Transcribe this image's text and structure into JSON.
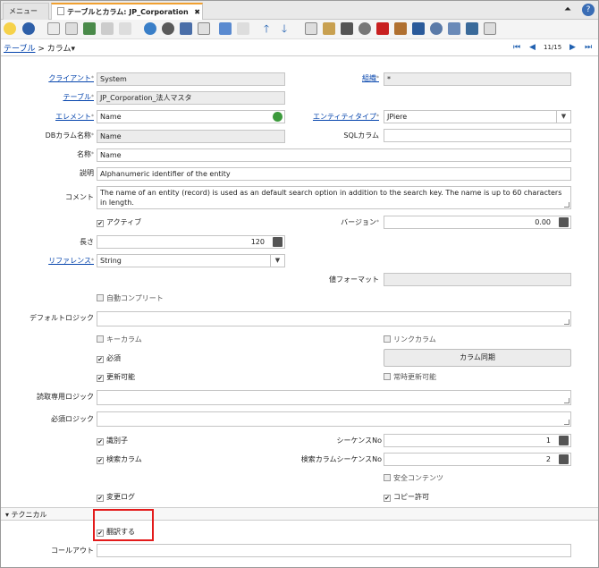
{
  "tabs": {
    "menu": "メニュー",
    "active": "テーブルとカラム: JP_Corporation",
    "close": "✖"
  },
  "breadcrumb": {
    "parent": "テーブル",
    "separator": ">",
    "current": "カラム▾"
  },
  "nav": {
    "record": "11/15"
  },
  "fields": {
    "client": {
      "label": "クライアント",
      "value": "System"
    },
    "org": {
      "label": "組織",
      "value": "*"
    },
    "table": {
      "label": "テーブル",
      "value": "JP_Corporation_法人マスタ"
    },
    "element": {
      "label": "エレメント",
      "value": "Name"
    },
    "entity": {
      "label": "エンティティタイプ",
      "value": "JPiere"
    },
    "dbcol": {
      "label": "DBカラム名称",
      "value": "Name"
    },
    "sqlcol": {
      "label": "SQLカラム",
      "value": ""
    },
    "name": {
      "label": "名称",
      "value": "Name"
    },
    "desc": {
      "label": "説明",
      "value": "Alphanumeric identifier of the entity"
    },
    "comment": {
      "label": "コメント",
      "value": "The name of an entity (record) is used as an default search option in addition to the search key. The name is up to 60 characters in length."
    },
    "active": {
      "label": "アクティブ"
    },
    "version": {
      "label": "バージョン",
      "value": "0.00"
    },
    "length": {
      "label": "長さ",
      "value": "120"
    },
    "reference": {
      "label": "リファレンス",
      "value": "String"
    },
    "format": {
      "label": "値フォーマット",
      "value": ""
    },
    "autocomplete": {
      "label": "自動コンプリート"
    },
    "defaultlogic": {
      "label": "デフォルトロジック",
      "value": ""
    },
    "keycol": {
      "label": "キーカラム"
    },
    "linkcol": {
      "label": "リンクカラム"
    },
    "mandatory": {
      "label": "必須"
    },
    "sync": {
      "label": "カラム同期"
    },
    "updatable": {
      "label": "更新可能"
    },
    "alwaysupd": {
      "label": "常時更新可能"
    },
    "readonlylogic": {
      "label": "読取専用ロジック",
      "value": ""
    },
    "mandlogic": {
      "label": "必須ロジック",
      "value": ""
    },
    "identifier": {
      "label": "識別子"
    },
    "seqno": {
      "label": "シーケンスNo",
      "value": "1"
    },
    "selcol": {
      "label": "検索カラム"
    },
    "selseq": {
      "label": "検索カラムシーケンスNo",
      "value": "2"
    },
    "secure": {
      "label": "安全コンテンツ"
    },
    "changelog": {
      "label": "変更ログ"
    },
    "copy": {
      "label": "コピー許可"
    },
    "translate": {
      "label": "翻訳する"
    },
    "callout": {
      "label": "コールアウト",
      "value": ""
    }
  },
  "section": {
    "label": "▾ テクニカル"
  },
  "colors": {
    "accent": "#f0a030",
    "link": "#0645ad",
    "highlight": "#e31b1b"
  }
}
